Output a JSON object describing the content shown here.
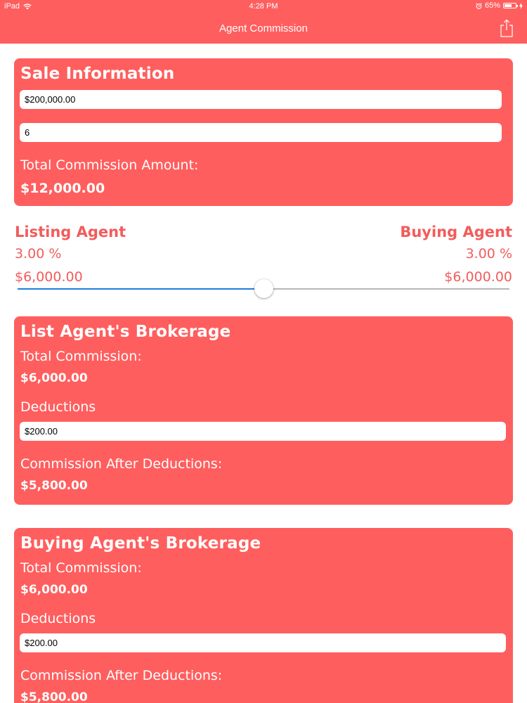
{
  "status_bar": {
    "device": "iPad",
    "time": "4:28 PM",
    "battery": "65%",
    "battery_level": 0.65
  },
  "nav": {
    "title": "Agent Commission",
    "share_icon": "share-icon"
  },
  "sale_info": {
    "title": "Sale Information",
    "price_value": "$200,000.00",
    "rate_value": "6",
    "total_label": "Total Commission Amount:",
    "total_value": "$12,000.00"
  },
  "split": {
    "listing_label": "Listing Agent",
    "listing_percent": "3.00 %",
    "listing_amount": "$6,000.00",
    "buying_label": "Buying Agent",
    "buying_percent": "3.00 %",
    "buying_amount": "$6,000.00",
    "slider_value": 0.5
  },
  "list_brokerage": {
    "title": "List Agent's Brokerage",
    "total_label": "Total Commission:",
    "total_value": "$6,000.00",
    "deductions_label": "Deductions",
    "deductions_value": "$200.00",
    "after_label": "Commission After Deductions:",
    "after_value": "$5,800.00"
  },
  "buy_brokerage": {
    "title": "Buying Agent's Brokerage",
    "total_label": "Total Commission:",
    "total_value": "$6,000.00",
    "deductions_label": "Deductions",
    "deductions_value": "$200.00",
    "after_label": "Commission After Deductions:",
    "after_value": "$5,800.00"
  },
  "colors": {
    "accent": "#ff5e5e",
    "text_accent": "#f25c5c",
    "slider_min": "#1d7fdc",
    "slider_max": "#b7b7b7"
  }
}
